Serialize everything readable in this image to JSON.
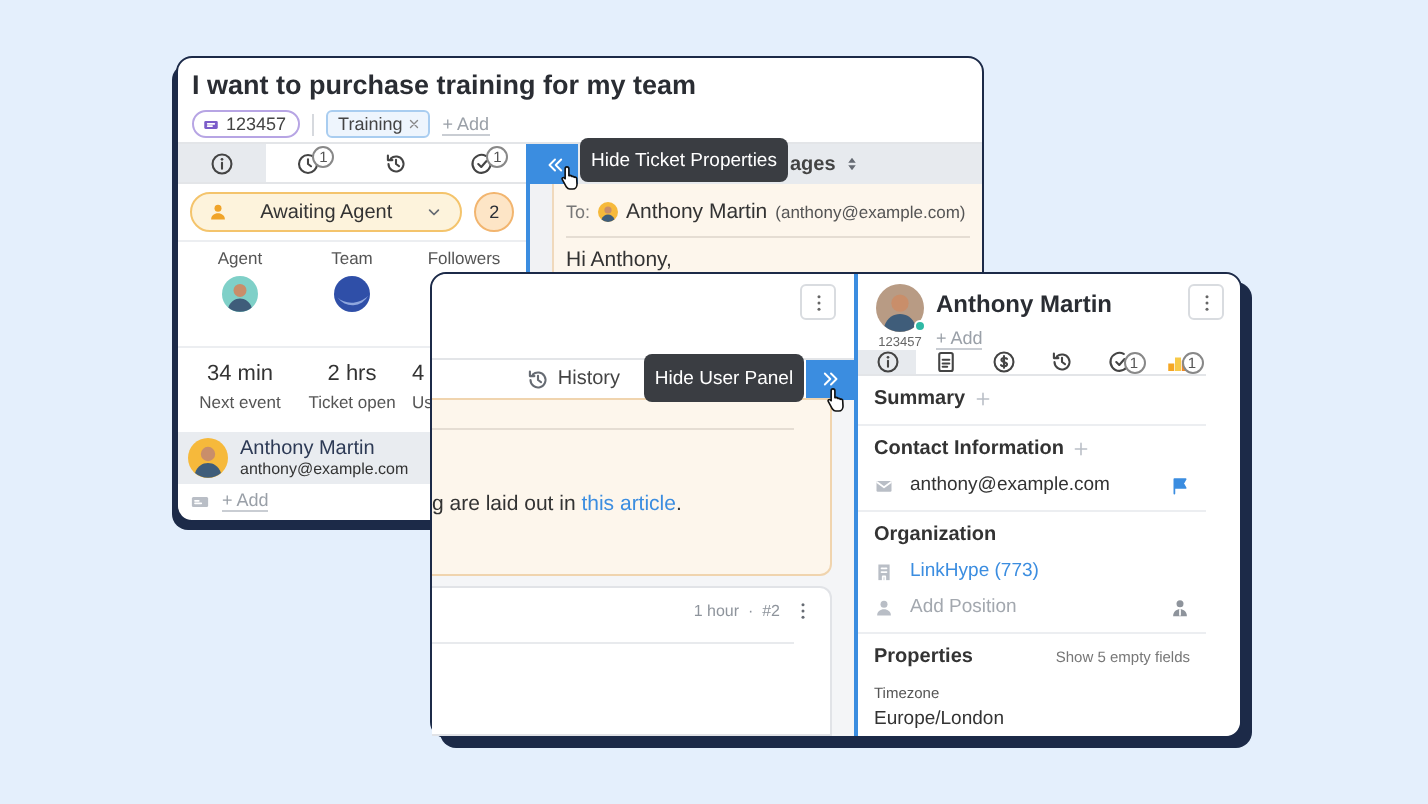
{
  "ticket_window": {
    "title": "I want to purchase training for my team",
    "ticket_id": "123457",
    "tags": [
      {
        "label": "Training"
      }
    ],
    "add_label": "+ Add",
    "property_tabs": [
      {
        "kind": "info",
        "selected": true
      },
      {
        "kind": "clock",
        "badge": "1",
        "selected": false
      },
      {
        "kind": "history",
        "selected": false
      },
      {
        "kind": "check",
        "badge": "1",
        "selected": false
      }
    ],
    "status": {
      "label": "Awaiting Agent",
      "count": "2"
    },
    "assignees": [
      {
        "label": "Agent",
        "kind": "person"
      },
      {
        "label": "Team",
        "kind": "team"
      },
      {
        "label": "Followers",
        "kind": "hidden"
      }
    ],
    "stats": [
      {
        "value": "34 min",
        "label": "Next event"
      },
      {
        "value": "2 hrs",
        "label": "Ticket open"
      },
      {
        "value": "4",
        "label": "Us"
      }
    ],
    "requester": {
      "name": "Anthony Martin",
      "email": "anthony@example.com"
    },
    "cc": {
      "add_label": "+ Add"
    },
    "toolbar": {
      "tooltip": "Hide Ticket Properties",
      "label": "ages"
    },
    "message": {
      "to_label": "To:",
      "name": "Anthony Martin",
      "email": "(anthony@example.com)",
      "greeting": "Hi Anthony,"
    }
  },
  "conversation_window": {
    "toolbar": {
      "history_label": "History",
      "tooltip": "Hide User Panel"
    },
    "message": {
      "text_before": "g are laid out in ",
      "link": "this article",
      "text_after": "."
    },
    "reply": {
      "meta": "1 hour  ·  #2"
    }
  },
  "user_panel": {
    "name": "Anthony Martin",
    "online": true,
    "user_id": "123457",
    "add_label": "+ Add",
    "tabs": [
      {
        "kind": "info",
        "selected": true
      },
      {
        "kind": "document",
        "selected": false
      },
      {
        "kind": "dollar",
        "selected": false
      },
      {
        "kind": "history",
        "selected": false
      },
      {
        "kind": "check",
        "badge": "1",
        "selected": false
      },
      {
        "kind": "chart",
        "badge": "1",
        "selected": false
      }
    ],
    "summary": {
      "title": "Summary",
      "addable": true
    },
    "contact": {
      "title": "Contact Information",
      "addable": true,
      "email": "anthony@example.com"
    },
    "organization": {
      "title": "Organization",
      "name": "LinkHype (773)",
      "position_placeholder": "Add Position"
    },
    "properties": {
      "title": "Properties",
      "toggle": "Show 5 empty fields",
      "fields": [
        {
          "label": "Timezone",
          "value": "Europe/London"
        }
      ]
    }
  }
}
